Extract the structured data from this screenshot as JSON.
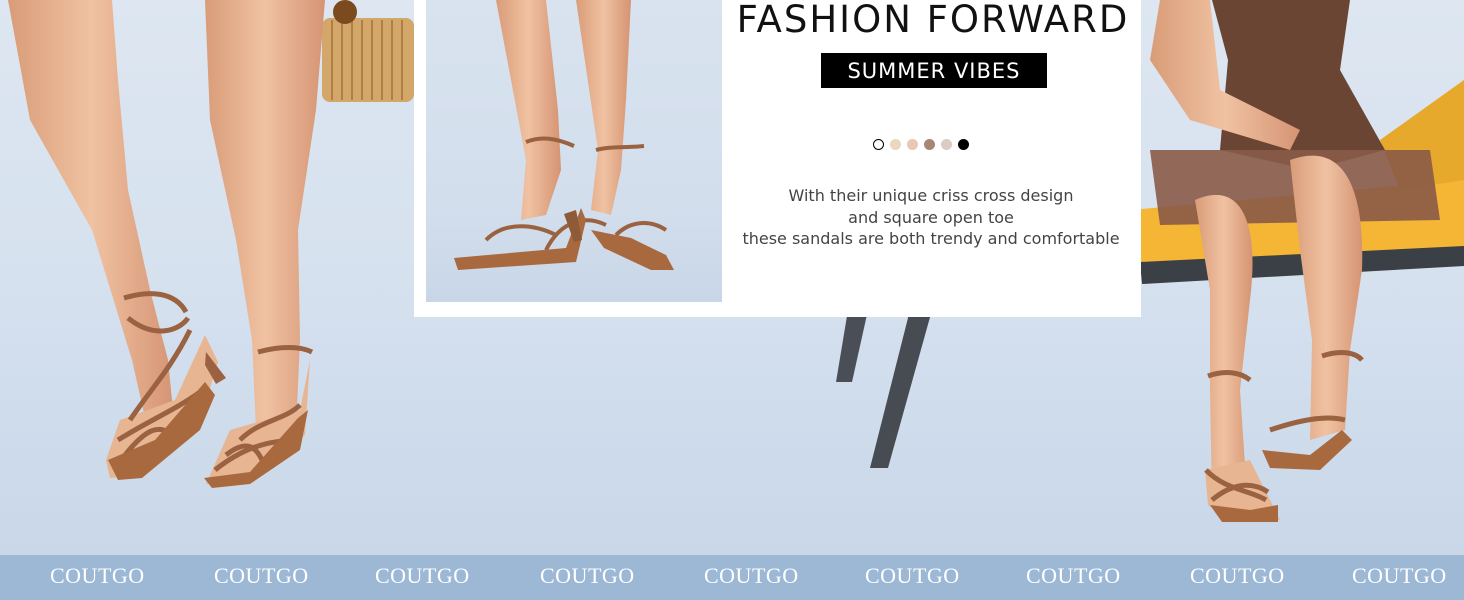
{
  "banner": {
    "headline": "FASHION FORWARD",
    "tagline": "SUMMER VIBES",
    "description_lines": [
      "With their unique criss cross design",
      "and square open toe",
      "these sandals are both trendy and comfortable"
    ]
  },
  "color_swatches": [
    {
      "name": "white",
      "color": "#ffffff",
      "border": "#000000"
    },
    {
      "name": "beige",
      "color": "#ead8bc",
      "border": "#ead8bc"
    },
    {
      "name": "nude",
      "color": "#e8c8b4",
      "border": "#e8c8b4"
    },
    {
      "name": "brown",
      "color": "#a98674",
      "border": "#a98674"
    },
    {
      "name": "taupe",
      "color": "#dccbc0",
      "border": "#dccbc0"
    },
    {
      "name": "black",
      "color": "#000000",
      "border": "#000000"
    }
  ],
  "footer": {
    "brand_repeat": [
      "COUTGO",
      "COUTGO",
      "COUTGO",
      "COUTGO",
      "COUTGO",
      "COUTGO",
      "COUTGO",
      "COUTGO",
      "COUTGO"
    ]
  },
  "colors": {
    "footer_bg": "#9cb8d5",
    "sandal": "#9a6240",
    "skin": "#e7b592"
  }
}
